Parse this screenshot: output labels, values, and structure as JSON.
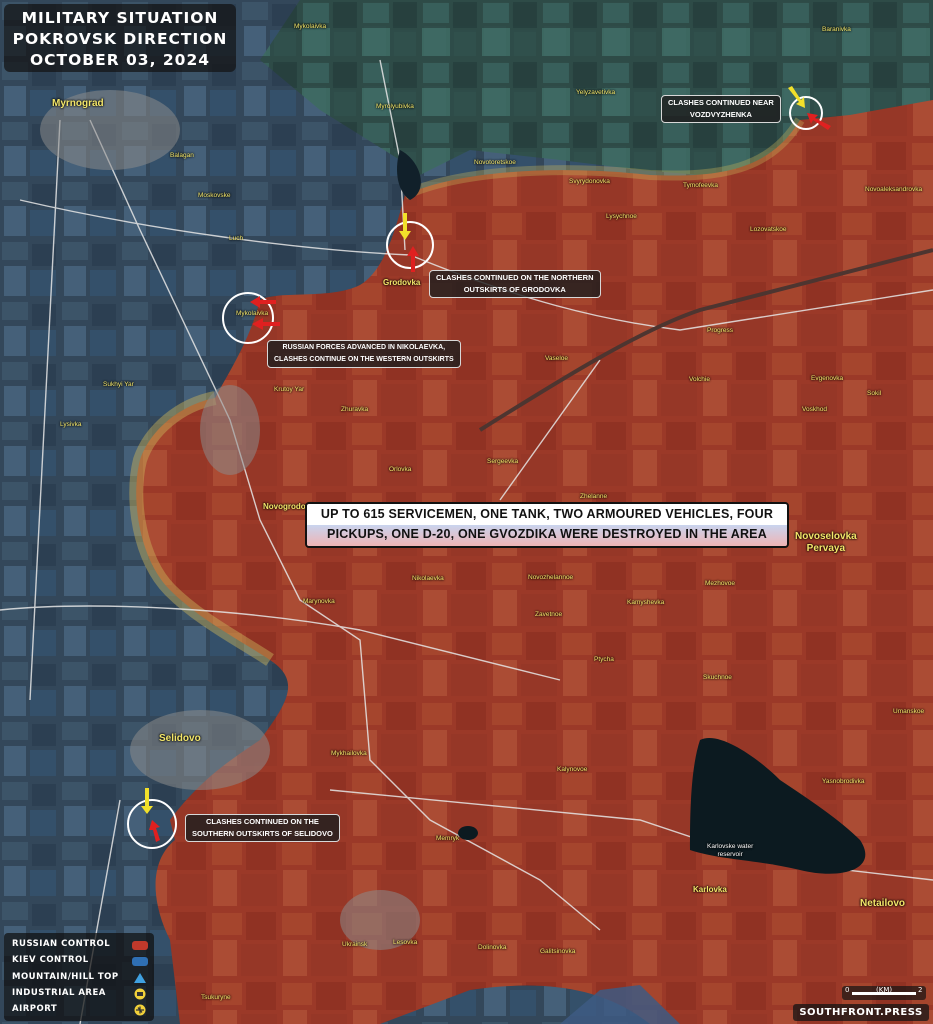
{
  "title": {
    "line1": "MILITARY SITUATION",
    "line2": "POKROVSK DIRECTION",
    "line3": "OCTOBER 03, 2024"
  },
  "colors": {
    "russian": "#c0392b",
    "kiev": "#2f6fb3",
    "arrow_russian": "#e02020",
    "arrow_kiev": "#f2e02a"
  },
  "places": {
    "myrnograd": "Myrnograd",
    "mykolaivka_n": "Mykolaivka",
    "myrolyubivka": "Myrolyubivka",
    "yelyzavetivka": "Yelyzavetivka",
    "baranivka": "Baranivka",
    "novotoretskoe": "Novotoretskoe",
    "svyrydonovka": "Svyrydonovka",
    "tymofeevka": "Tymofeevka",
    "novoaleksandrovka": "Novoaleksandrovka",
    "lysychnoe": "Lysychnoe",
    "lozovatskoe": "Lozovatskoe",
    "balagan": "Balagan",
    "moskovske": "Moskovske",
    "luch": "Luch",
    "grodovka": "Grodovka",
    "mykolaivka_w": "Mykolaivka",
    "progress": "Progress",
    "vaseloe": "Vaseloe",
    "volchie": "Volchie",
    "evgenovka": "Evgenovka",
    "sokil": "Sokil",
    "voskhod": "Voskhod",
    "sukhyi_yar": "Sukhyi Yar",
    "krutoy_yar": "Krutoy Yar",
    "lysivka": "Lysivka",
    "zhuravka": "Zhuravka",
    "orlovka": "Orlovka",
    "sergeevka": "Sergeevka",
    "zhelanne": "Zhelanne",
    "novogrodovka": "Novogrodovka",
    "novoselovka_pervaya": "Novoselovka\nPervaya",
    "nikolaevka": "Nikolaevka",
    "novozhelannoe": "Novozhelannoe",
    "mezhovoe": "Mezhovoe",
    "marynovka": "Marynovka",
    "zavetnoe": "Zavetnoe",
    "kamyshevka": "Kamyshevka",
    "ptycha": "Ptycha",
    "skuchnoe": "Skuchnoe",
    "umanskoe": "Umanskoe",
    "selidovo": "Selidovo",
    "mykhailovka": "Mykhailovka",
    "kalynovoe": "Kalynovoe",
    "yasnobrodivka": "Yasnobrodivka",
    "memryk": "Memryk",
    "karlovske_reservoir": "Karlovske water\nreservoir",
    "karlovka": "Karlovka",
    "netailovo": "Netailovo",
    "ukrainsk": "Ukrainsk",
    "lesovka": "Lesovka",
    "dolinovka": "Dolinovka",
    "galitsinovka": "Galitsinovka",
    "tsukuryne": "Tsukuryne"
  },
  "callouts": {
    "vozdvyzhenka": "CLASHES CONTINUED NEAR\nVOZDVYZHENKA",
    "grodovka": "CLASHES CONTINUED ON THE NORTHERN\nOUTSKIRTS OF GRODOVKA",
    "nikolaevka": "RUSSIAN FORCES ADVANCED IN NIKOLAEVKA,\nCLASHES CONTINUE ON THE WESTERN OUTSKIRTS",
    "selidovo": "CLASHES CONTINUED ON THE\nSOUTHERN OUTSKIRTS OF SELIDOVO"
  },
  "banner": {
    "line1": "UP TO 615 SERVICEMEN, ONE TANK, TWO ARMOURED VEHICLES, FOUR",
    "line2": "PICKUPS, ONE D-20, ONE GVOZDIKA WERE DESTROYED IN THE AREA"
  },
  "legend": {
    "russian_control": "RUSSIAN CONTROL",
    "kiev_control": "KIEV CONTROL",
    "mountain": "MOUNTAIN/HILL TOP",
    "industrial": "INDUSTRIAL AREA",
    "airport": "AIRPORT"
  },
  "scale": {
    "zero": "0",
    "unit": "(KM)",
    "two": "2"
  },
  "credit": "SOUTHFRONT.PRESS"
}
